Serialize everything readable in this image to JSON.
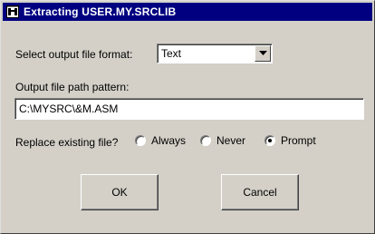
{
  "window": {
    "title": "Extracting USER.MY.SRCLIB"
  },
  "format": {
    "label": "Select output file format:",
    "selected": "Text"
  },
  "path": {
    "label": "Output file path pattern:",
    "value": "C:\\MYSRC\\&M.ASM"
  },
  "replace": {
    "label": "Replace existing file?",
    "options": [
      {
        "label": "Always",
        "checked": false
      },
      {
        "label": "Never",
        "checked": false
      },
      {
        "label": "Prompt",
        "checked": true
      }
    ]
  },
  "buttons": {
    "ok": "OK",
    "cancel": "Cancel"
  },
  "colors": {
    "titlebar": "#000080",
    "face": "#d4d0c8"
  },
  "icons": {
    "app": "cassette-tape-icon",
    "dropdown": "triangle-down-icon"
  }
}
